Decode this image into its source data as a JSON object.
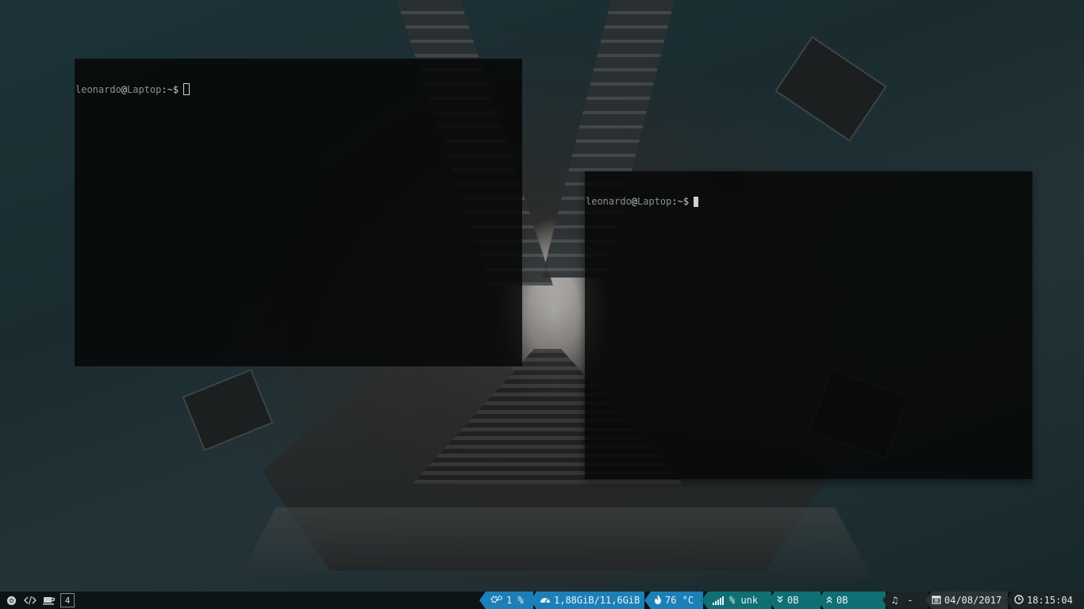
{
  "terminals": [
    {
      "user": "leonardo",
      "at": "@",
      "host": "Laptop",
      "path": ":~$",
      "cursor": "hollow"
    },
    {
      "user": "leonardo",
      "at": "@",
      "host": "Laptop",
      "path": ":~$",
      "cursor": "solid"
    }
  ],
  "bar": {
    "left": {
      "icons": [
        "chrome-icon",
        "code-icon",
        "coffee-icon"
      ],
      "workspace": "4"
    },
    "cpu": {
      "icon": "gears-icon",
      "text": "1 %"
    },
    "memory": {
      "icon": "dashboard-icon",
      "text": "1,88GiB/11,6GiB"
    },
    "temperature": {
      "icon": "fire-icon",
      "text": "76 °C"
    },
    "wifi": {
      "icon": "signal-icon",
      "text": "% unk"
    },
    "download": {
      "icon": "double-chevron-down-icon",
      "text": "0B"
    },
    "upload": {
      "icon": "double-chevron-up-icon",
      "text": "0B"
    },
    "music": {
      "icon": "music-note-icon",
      "text": "-"
    },
    "date": {
      "icon": "calendar-icon",
      "text": "04/08/2017"
    },
    "time": {
      "icon": "clock-icon",
      "text": "18:15:04"
    },
    "colors": {
      "blue": "#1c7fb8",
      "teal": "#0f6f73",
      "bar_bg": "#0c1416"
    }
  }
}
